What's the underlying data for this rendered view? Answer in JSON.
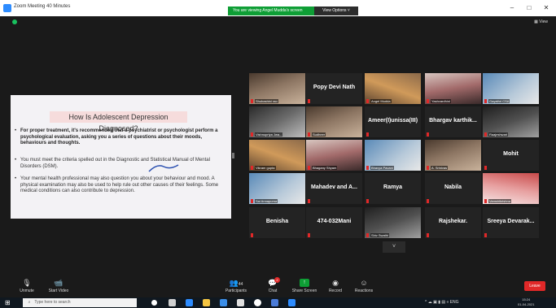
{
  "window": {
    "title": "Zoom Meeting 40 Minutes",
    "viewing_banner": "You are viewing Angel Mudda's screen",
    "view_options": "View Options ˅",
    "view_toggle": "▦ View",
    "controls": [
      "–",
      "□",
      "✕"
    ]
  },
  "slide": {
    "title": "How Is Adolescent Depression Diagnosed?",
    "bullets": [
      "For proper treatment, it's recommended that a psychiatrist or psychologist perform a psychological evaluation, asking you a series of questions about their moods, behaviours and thoughts.",
      "You must meet the criteria spelled out in the Diagnostic and Statistical Manual of Mental Disorders (DSM).",
      "Your mental health professional may also question you about your behaviour and mood. A physical examination may also be used to help rule out other causes of their feelings. Some medical conditions can also contribute to depression."
    ],
    "bullet_mark": "•"
  },
  "participants": [
    {
      "name": "",
      "label": "Shubashini rao",
      "video": true,
      "style": "vid-a"
    },
    {
      "name": "Popy Devi Nath",
      "label": "",
      "video": false
    },
    {
      "name": "",
      "label": "Angel Mudda",
      "video": true,
      "style": "vid-b",
      "active": true
    },
    {
      "name": "",
      "label": "Yashvardhini",
      "video": true,
      "style": "vid-d"
    },
    {
      "name": "",
      "label": "Gayathri CSA",
      "video": true,
      "style": "vid-e"
    },
    {
      "name": "",
      "label": "Vishnupriya Jwa...",
      "video": true,
      "style": "vid-c"
    },
    {
      "name": "",
      "label": "Sudheer",
      "video": true,
      "style": "vid-a"
    },
    {
      "name": "Ameer(I)unissa(III)",
      "label": "",
      "video": false
    },
    {
      "name": "Bhargav  karthik...",
      "label": "",
      "video": false
    },
    {
      "name": "",
      "label": "Raajeshwari",
      "video": true,
      "style": "vid-g"
    },
    {
      "name": "",
      "label": "Vikram gupta",
      "video": true,
      "style": "vid-b"
    },
    {
      "name": "",
      "label": "Bhagany Shyam",
      "video": true,
      "style": "vid-d"
    },
    {
      "name": "",
      "label": "Bhavya Pavani",
      "video": true,
      "style": "vid-e"
    },
    {
      "name": "",
      "label": "A. Srinivas",
      "video": true,
      "style": "vid-a"
    },
    {
      "name": "Mohit",
      "label": "",
      "video": false
    },
    {
      "name": "",
      "label": "Sai Annapurna",
      "video": true,
      "style": "vid-e"
    },
    {
      "name": "Mahadev and A...",
      "label": "",
      "video": false
    },
    {
      "name": "Ramya",
      "label": "",
      "video": false
    },
    {
      "name": "Nabila",
      "label": "",
      "video": false
    },
    {
      "name": "",
      "label": "Vamshikrishna",
      "video": true,
      "style": "vid-f"
    },
    {
      "name": "Benisha",
      "label": "",
      "video": false
    },
    {
      "name": "474-032Mani",
      "label": "",
      "video": false
    },
    {
      "name": "",
      "label": "Shiv Swathi",
      "video": true,
      "style": "vid-g"
    },
    {
      "name": "Rajshekar.",
      "label": "",
      "video": false
    },
    {
      "name": "Sreeya  Devarak...",
      "label": "",
      "video": false
    }
  ],
  "scroll_down": "˅",
  "toolbar": {
    "unmute": "Unmute",
    "unmute_icon": "🎙",
    "start_video": "Start Video",
    "video_icon": "📹",
    "participants": "Participants",
    "participants_count": "44",
    "participants_icon": "👥",
    "chat": "Chat",
    "chat_badge": "2",
    "chat_icon": "💬",
    "share_screen": "Share Screen",
    "share_icon": "↑",
    "record": "Record",
    "record_icon": "◉",
    "reactions": "Reactions",
    "reactions_icon": "☺",
    "leave": "Leave",
    "caret": "^"
  },
  "taskbar": {
    "start_icon": "⊞",
    "search_placeholder": "Type here to search",
    "search_icon": "⌕",
    "tray_text": "^ ☁ ▣ ▮ ▤ « ENG",
    "time": "15:24",
    "date": "01-04-2021"
  },
  "colors": {
    "viewing_green": "#0e9e35",
    "leave_red": "#e02828",
    "active_speaker": "#c9e02d",
    "slide_title_bg": "#f6dcdc"
  }
}
